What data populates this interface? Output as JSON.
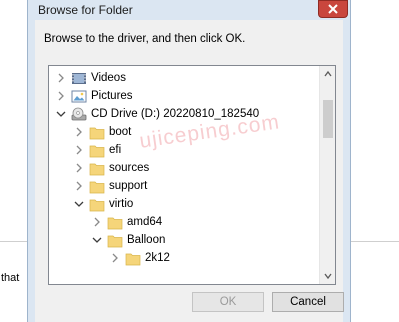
{
  "background": {
    "side_text": "that"
  },
  "dialog": {
    "title": "Browse for Folder",
    "instruction": "Browse to the driver, and then click OK.",
    "buttons": {
      "ok_label": "OK",
      "cancel_label": "Cancel"
    }
  },
  "tree": {
    "items": [
      {
        "label": "Videos",
        "icon": "video-library-icon",
        "expander": "collapsed"
      },
      {
        "label": "Pictures",
        "icon": "pictures-library-icon",
        "expander": "collapsed"
      },
      {
        "label": "CD Drive (D:) 20220810_182540",
        "icon": "cd-drive-icon",
        "expander": "expanded"
      },
      {
        "label": "boot",
        "icon": "folder-icon",
        "expander": "collapsed"
      },
      {
        "label": "efi",
        "icon": "folder-icon",
        "expander": "collapsed"
      },
      {
        "label": "sources",
        "icon": "folder-icon",
        "expander": "collapsed"
      },
      {
        "label": "support",
        "icon": "folder-icon",
        "expander": "collapsed"
      },
      {
        "label": "virtio",
        "icon": "folder-icon",
        "expander": "expanded"
      },
      {
        "label": "amd64",
        "icon": "folder-icon",
        "expander": "collapsed"
      },
      {
        "label": "Balloon",
        "icon": "folder-icon",
        "expander": "expanded"
      },
      {
        "label": "2k12",
        "icon": "folder-icon",
        "expander": "collapsed"
      }
    ]
  },
  "watermark": "ujiceping.com",
  "colors": {
    "dialog_frame": "#dbe6f2",
    "close_button": "#c9463d",
    "folder": "#f5d57a",
    "scroll_thumb": "#cdcdcd"
  }
}
